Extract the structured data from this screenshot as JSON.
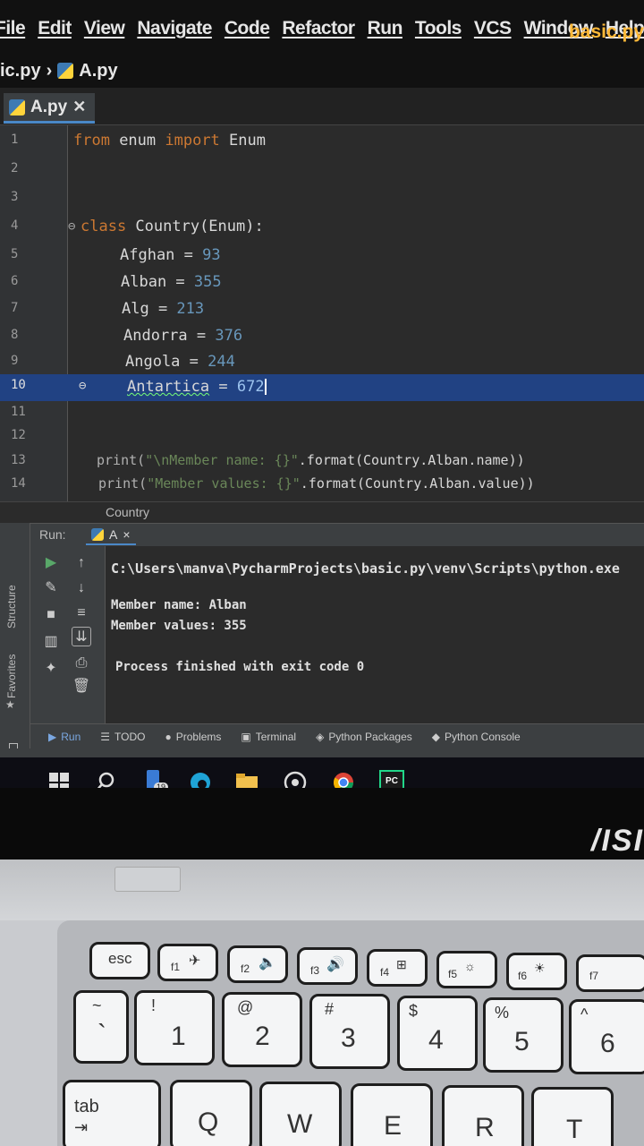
{
  "menu": {
    "items": [
      "File",
      "Edit",
      "View",
      "Navigate",
      "Code",
      "Refactor",
      "Run",
      "Tools",
      "VCS",
      "Window",
      "Help"
    ],
    "project": "basic.py"
  },
  "breadcrumb": {
    "parent": "ic.py",
    "file": "A.py"
  },
  "tab": {
    "label": "A.py",
    "close": "✕"
  },
  "editor": {
    "lines": [
      {
        "n": "1"
      },
      {
        "n": "2"
      },
      {
        "n": "3"
      },
      {
        "n": "4"
      },
      {
        "n": "5"
      },
      {
        "n": "6"
      },
      {
        "n": "7"
      },
      {
        "n": "8"
      },
      {
        "n": "9"
      },
      {
        "n": "10"
      },
      {
        "n": "11"
      },
      {
        "n": "12"
      },
      {
        "n": "13"
      },
      {
        "n": "14"
      }
    ],
    "code": {
      "l1_kw1": "from",
      "l1_mod": " enum ",
      "l1_kw2": "import",
      "l1_name": " Enum",
      "l4_kw": "class",
      "l4_rest": " Country(Enum):",
      "l5_name": "Afghan = ",
      "l5_val": "93",
      "l6_name": "Alban = ",
      "l6_val": "355",
      "l7_name": "Alg = ",
      "l7_val": "213",
      "l8_name": "Andorra = ",
      "l8_val": "376",
      "l9_name": "Angola = ",
      "l9_val": "244",
      "l10_name": "Antartica",
      "l10_eq": " = ",
      "l10_val": "672",
      "l13_fn": "print(",
      "l13_str": "\"\\nMember name: {}\"",
      "l13_rest": ".format(Country.Alban.name))",
      "l14_fn": "print(",
      "l14_str": "\"Member values: {}\"",
      "l14_rest": ".format(Country.Alban.value))"
    },
    "scope_crumb": "Country"
  },
  "run": {
    "label": "Run:",
    "tab": "A",
    "tab_close": "×",
    "console": [
      "C:\\Users\\manva\\PycharmProjects\\basic.py\\venv\\Scripts\\python.exe",
      "Member name: Alban",
      "Member values: 355",
      "Process finished with exit code 0"
    ]
  },
  "side_labels": {
    "structure": "Structure",
    "favorites": "Favorites"
  },
  "bottom_tabs": [
    "Run",
    "TODO",
    "Problems",
    "Terminal",
    "Python Packages",
    "Python Console"
  ],
  "taskbar": {
    "badge": "19",
    "pycharm": "PC"
  },
  "laptop": {
    "brand": "/ISI",
    "keys_fn": [
      "esc",
      "f1",
      "f2",
      "f3",
      "f4",
      "f5",
      "f6",
      "f7"
    ],
    "keys_num": [
      {
        "main": "`",
        "sub": "~"
      },
      {
        "main": "1",
        "sub": "!"
      },
      {
        "main": "2",
        "sub": "@"
      },
      {
        "main": "3",
        "sub": "#"
      },
      {
        "main": "4",
        "sub": "$"
      },
      {
        "main": "5",
        "sub": "%"
      },
      {
        "main": "6",
        "sub": "^"
      }
    ],
    "keys_row3": [
      "tab",
      "Q",
      "W",
      "E",
      "R",
      "T"
    ]
  },
  "colors": {
    "keyword": "#cc7832",
    "number": "#6897bb",
    "string": "#6a8759",
    "selection": "#214283",
    "project": "#ffb938"
  }
}
